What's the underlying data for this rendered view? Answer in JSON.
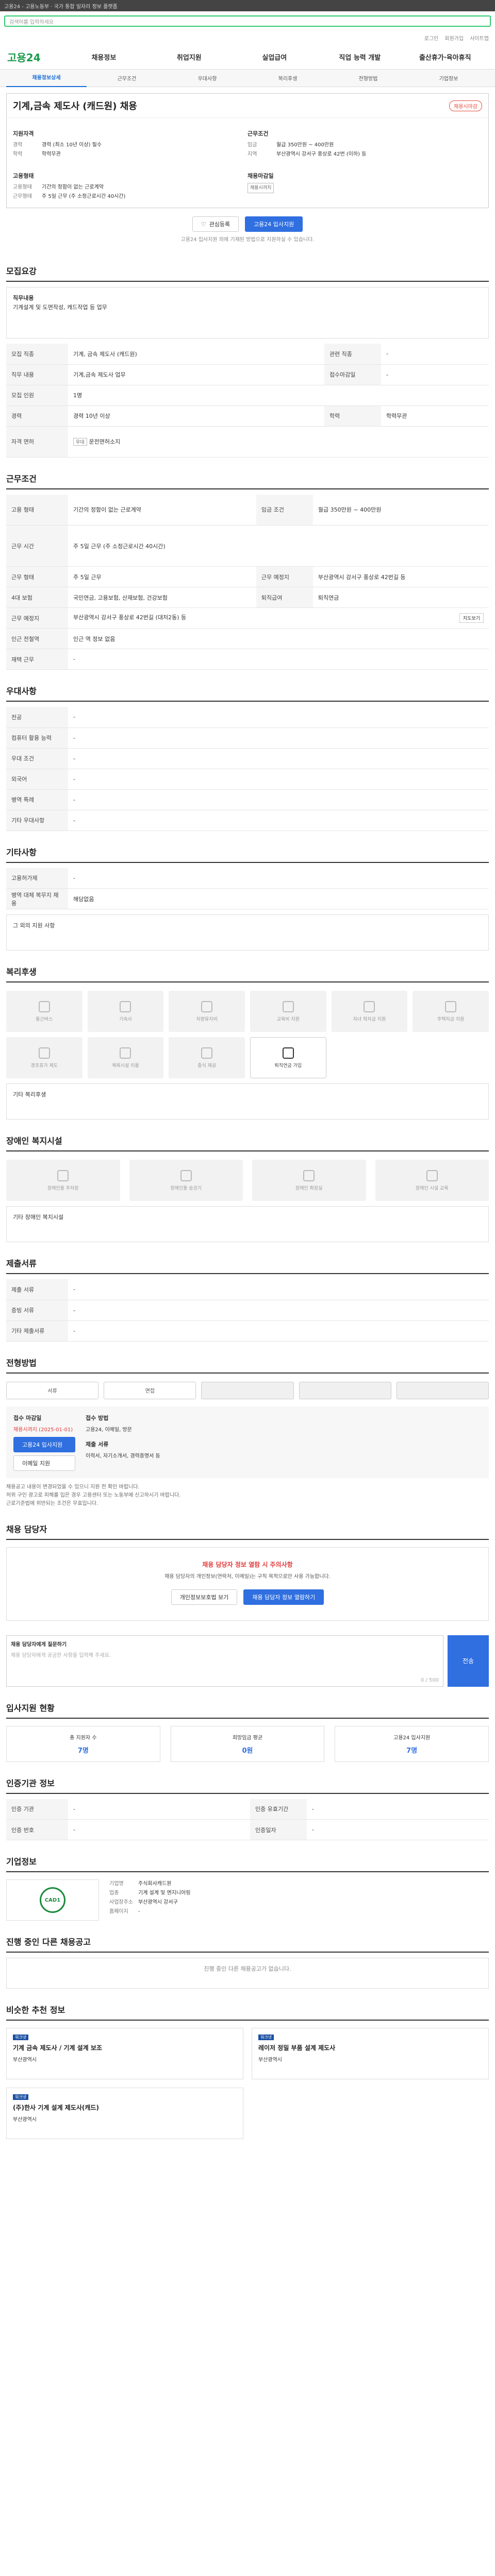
{
  "topbar": "고용24 - 고용노동부 · 국가 통합 일자리 정보 플랫폼",
  "search_placeholder": "검색어를 입력하세요",
  "hdr": [
    "로그인",
    "회원가입",
    "사이트맵"
  ],
  "logo": "고용24",
  "gnb": [
    "채용정보",
    "취업지원",
    "실업급여",
    "직업 능력 개발",
    "출산휴가·육아휴직"
  ],
  "subnav": [
    "채용정보상세",
    "근무조건",
    "우대사항",
    "복리후생",
    "전형방법",
    "기업정보"
  ],
  "job": {
    "title": "기계,금속 제도사 (캐드원) 채용",
    "badge": "채용시마감",
    "req_title": "지원자격",
    "req": [
      [
        "경력",
        "경력 (최소 10년 이상) 필수"
      ],
      [
        "학력",
        "학력무관"
      ]
    ],
    "cond_title": "근무조건",
    "cond": [
      [
        "임금",
        "월급 350만원 ~ 400만원"
      ],
      [
        "지역",
        "부산광역시 강서구 풍상로 42번 (이하) 등"
      ]
    ],
    "emp_title": "고용형태",
    "emp": [
      [
        "고용형태",
        "기간의 정함이 없는 근로계약"
      ],
      [
        "근무형태",
        "주 5일 근무 (주 소정근로시간 40시간)"
      ]
    ],
    "close_title": "채용마감일",
    "close": "채용시까지"
  },
  "act": {
    "save": "관심등록",
    "apply": "고용24 입사지원"
  },
  "act_note": "고용24 입사지원 외에 기재된 방법으로 지원하실 수 있습니다.",
  "sec1": {
    "title": "모집요강",
    "job_title": "직무내용",
    "job_desc": "기계설계 및 도면작성, 캐드작업 등 업무",
    "rows": [
      [
        "모집 직종",
        "기계, 금속 제도사 (캐드원)",
        "관련 직종",
        "-"
      ],
      [
        "직무 내용",
        "기계,금속 제도사 업무",
        "접수마감일",
        "-"
      ],
      [
        "모집 인원",
        "1명",
        "",
        ""
      ],
      [
        "경력",
        "경력 10년 이상",
        "학력",
        "학력무관"
      ],
      [
        "자격 면허",
        "-",
        "",
        ""
      ]
    ],
    "tags": [
      "우대",
      "운전면허소지"
    ]
  },
  "sec2": {
    "title": "근무조건",
    "rows": [
      [
        "고용 형태",
        "기간의 정함이 없는 근로계약",
        "임금 조건",
        "월급 350만원 ~ 400만원"
      ],
      [
        "근무 시간",
        "주 5일 근무 (주 소정근로시간 40시간)",
        "",
        ""
      ],
      [
        "근무 형태",
        "주 5일 근무",
        "근무 예정지",
        "부산광역시 강서구 풍상로 42번길 등"
      ],
      [
        "4대 보험",
        "국민연금, 고용보험, 산재보험, 건강보험",
        "퇴직급여",
        "퇴직연금"
      ],
      [
        "근무 예정지",
        "부산광역시 강서구 풍상로 42번길 (대저2동) 등",
        "",
        ""
      ],
      [
        "인근 전철역",
        "인근 역 정보 없음",
        "",
        ""
      ],
      [
        "재택 근무",
        "-",
        "",
        ""
      ]
    ],
    "map_btn": "지도보기"
  },
  "sec3": {
    "title": "우대사항",
    "rows": [
      [
        "전공",
        "-"
      ],
      [
        "컴퓨터 활용 능력",
        "-"
      ],
      [
        "우대 조건",
        "-"
      ],
      [
        "외국어",
        "-"
      ],
      [
        "병역 특례",
        "-"
      ],
      [
        "기타 우대사항",
        "-"
      ]
    ]
  },
  "sec4": {
    "title": "기타사항",
    "rows": [
      [
        "고용허가제",
        "-"
      ],
      [
        "병역 대체 복무지 채용",
        "해당없음"
      ]
    ],
    "etc": "그 외의 지원 사항"
  },
  "sec5": {
    "title": "복리후생",
    "items": [
      "통근버스",
      "기숙사",
      "차량유지비",
      "교육비 지원",
      "자녀 학자금 지원",
      "주택자금 지원",
      "경조휴가 제도",
      "체육시설 이용",
      "중식 제공",
      "퇴직연금 가입"
    ],
    "other": "기타 복리후생"
  },
  "sec6": {
    "title": "장애인 복지시설",
    "items": [
      "장애인용 주차장",
      "장애인용 승강기",
      "장애인 화장실",
      "장애인 시설 교육"
    ],
    "other": "기타 장애인 복지시설"
  },
  "sec7": {
    "title": "제출서류",
    "rows": [
      [
        "제출 서류",
        "-"
      ],
      [
        "증빙 서류",
        "-"
      ],
      [
        "기타 제출서류",
        "-"
      ]
    ]
  },
  "sec8": {
    "title": "전형방법",
    "steps": [
      "서류",
      "면접",
      "",
      "",
      ""
    ],
    "proc": {
      "due_t": "접수 마감일",
      "due": "채용시까지 (2025-01-01)",
      "apply_btn": "고용24 입사지원",
      "email_btn": "이메일 지원",
      "method_t": "접수 방법",
      "method": "고용24, 이메일, 방문",
      "docs_t": "제출 서류",
      "docs": "이력서, 자기소개서, 경력증명서 등"
    },
    "notes": [
      "채용공고 내용이 변경되었을 수 있으니 지원 전 확인 바랍니다.",
      "허위 구인 광고로 피해를 입은 경우 고용센터 또는 노동부에 신고하시기 바랍니다.",
      "근로기준법에 위반되는 조건은 무효입니다."
    ]
  },
  "sec9": {
    "title": "채용 담당자",
    "warn": "채용 담당자 정보 열람 시 주의사항",
    "desc": "채용 담당자의 개인정보(연락처, 이메일)는 구직 목적으로만 사용 가능합니다.",
    "btn1": "개인정보보호법 보기",
    "btn2": "채용 담당자 정보 열람하기"
  },
  "sec10": {
    "title": "채용 담당자에게 질문하기",
    "ph": "채용 담당자에게 궁금한 사항을 입력해 주세요.",
    "btn": "전송",
    "count": "0 / 500"
  },
  "sec11": {
    "title": "입사지원 현황",
    "stats": [
      [
        "총 지원자 수",
        "7명"
      ],
      [
        "희망임금 평균",
        "0원"
      ],
      [
        "고용24 입사지원",
        "7명"
      ]
    ]
  },
  "sec12": {
    "title": "인증기관 정보",
    "rows": [
      [
        "인증 기관",
        "-",
        "인증 유효기간",
        "-"
      ],
      [
        "인증 번호",
        "-",
        "인증일자",
        "-"
      ]
    ]
  },
  "sec13": {
    "title": "기업정보",
    "rows": [
      [
        "기업명",
        "주식회사캐드원"
      ],
      [
        "업종",
        "기계 설계 및 엔지니어링"
      ],
      [
        "사업장주소",
        "부산광역시 강서구"
      ],
      [
        "홈페이지",
        "-"
      ]
    ],
    "logo": "CAD1"
  },
  "sec14": {
    "title": "진행 중인 다른 채용공고",
    "empty": "진행 중인 다른 채용공고가 없습니다."
  },
  "sec15": {
    "title": "비슷한 추천 정보",
    "cards": [
      [
        "워크넷",
        "기계 금속 제도사 / 기계 설계 보조",
        "부산광역시"
      ],
      [
        "워크넷",
        "레이저 정밀 부품 설계 제도사",
        "부산광역시"
      ],
      [
        "워크넷",
        "(주)한사 기계 설계 제도사(캐드)",
        "부산광역시"
      ]
    ]
  }
}
